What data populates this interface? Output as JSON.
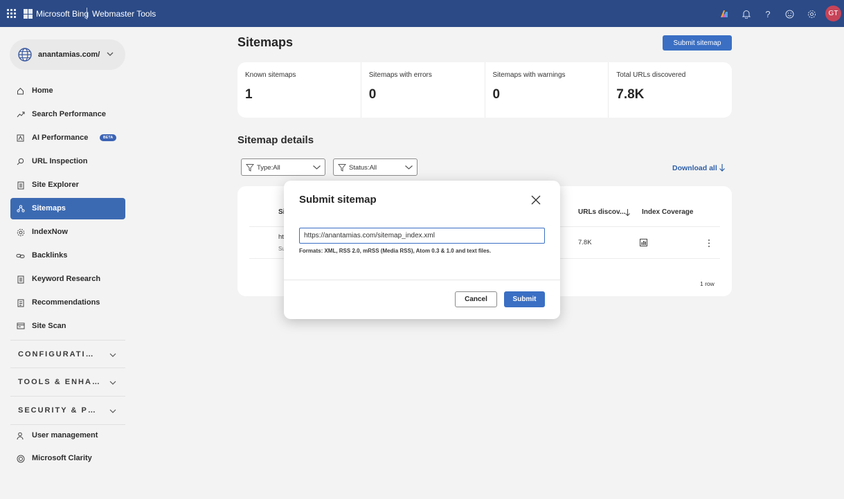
{
  "header": {
    "brand": "Microsoft Bing",
    "product": "Webmaster Tools",
    "avatar_initials": "GT"
  },
  "site": {
    "name": "anantamias.com/"
  },
  "sidebar": {
    "items": [
      {
        "label": "Home",
        "icon": "home-icon"
      },
      {
        "label": "Search Performance",
        "icon": "trend-icon"
      },
      {
        "label": "AI Performance",
        "icon": "ai-icon",
        "badge": "BETA"
      },
      {
        "label": "URL Inspection",
        "icon": "magnifier-icon"
      },
      {
        "label": "Site Explorer",
        "icon": "document-icon"
      },
      {
        "label": "Sitemaps",
        "icon": "sitemap-icon",
        "active": true
      },
      {
        "label": "IndexNow",
        "icon": "gear-icon"
      },
      {
        "label": "Backlinks",
        "icon": "link-icon"
      },
      {
        "label": "Keyword Research",
        "icon": "document-icon"
      },
      {
        "label": "Recommendations",
        "icon": "list-icon"
      },
      {
        "label": "Site Scan",
        "icon": "scan-icon"
      }
    ],
    "sections": [
      {
        "label": "CONFIGURATION"
      },
      {
        "label": "TOOLS & ENHANCEMENTS"
      },
      {
        "label": "SECURITY & PRIVACY"
      }
    ],
    "bottom_items": [
      {
        "label": "User management",
        "icon": "user-icon"
      },
      {
        "label": "Microsoft Clarity",
        "icon": "clarity-icon"
      }
    ]
  },
  "main": {
    "title": "Sitemaps",
    "submit_button": "Submit sitemap",
    "stats": [
      {
        "label": "Known sitemaps",
        "value": "1"
      },
      {
        "label": "Sitemaps with errors",
        "value": "0"
      },
      {
        "label": "Sitemaps with warnings",
        "value": "0"
      },
      {
        "label": "Total URLs discovered",
        "value": "7.8K"
      }
    ],
    "details_title": "Sitemap details",
    "filters": [
      {
        "label": "Type:All"
      },
      {
        "label": "Status:All"
      }
    ],
    "download_all": "Download all",
    "table": {
      "header_first": "Si",
      "header_urls": "URLs discov...",
      "header_index": "Index Coverage",
      "row_first": "ht",
      "row_second": "Su",
      "row_urls": "7.8K",
      "row_count": "1 row"
    }
  },
  "modal": {
    "title": "Submit sitemap",
    "input_value": "https://anantamias.com/sitemap_index.xml",
    "hint": "Formats: XML, RSS 2.0, mRSS (Media RSS), Atom 0.3 & 1.0 and text files.",
    "cancel": "Cancel",
    "submit": "Submit"
  },
  "colors": {
    "topbar": "#2b4a86",
    "accent": "#3a6fc4",
    "active_nav": "#3c6ab2",
    "avatar": "#c74458"
  }
}
